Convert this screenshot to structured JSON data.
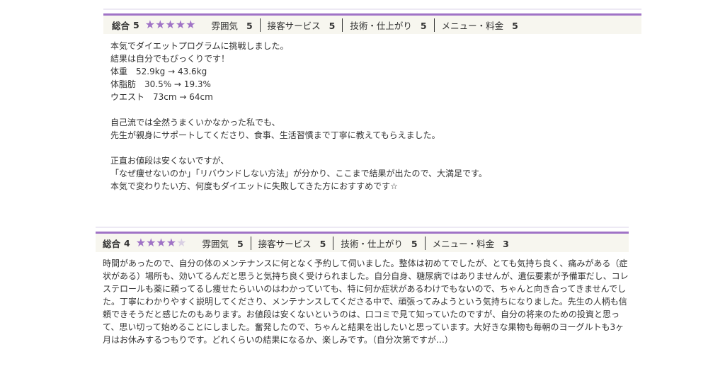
{
  "reviews": [
    {
      "total_label": "総合",
      "total_score": "5",
      "stars_filled": 5,
      "stars_max": 5,
      "categories": [
        {
          "label": "雰囲気",
          "score": "5"
        },
        {
          "label": "接客サービス",
          "score": "5"
        },
        {
          "label": "技術・仕上がり",
          "score": "5"
        },
        {
          "label": "メニュー・料金",
          "score": "5"
        }
      ],
      "lines": [
        "本気でダイエットプログラムに挑戦しました。",
        "結果は自分でもびっくりです！",
        "体重　52.9kg → 43.6kg",
        "体脂肪　30.5% → 19.3%",
        "ウエスト　73cm → 64cm",
        "",
        "自己流では全然うまくいかなかった私でも、",
        "先生が親身にサポートしてくださり、食事、生活習慣まで丁寧に教えてもらえました。",
        "",
        "正直お値段は安くないですが、",
        "「なぜ痩せないのか」「リバウンドしない方法」が分かり、ここまで結果が出たので、大満足です。",
        "本気で変わりたい方、何度もダイエットに失敗してきた方におすすめです☆"
      ]
    },
    {
      "total_label": "総合",
      "total_score": "4",
      "stars_filled": 4,
      "stars_max": 5,
      "categories": [
        {
          "label": "雰囲気",
          "score": "5"
        },
        {
          "label": "接客サービス",
          "score": "5"
        },
        {
          "label": "技術・仕上がり",
          "score": "5"
        },
        {
          "label": "メニュー・料金",
          "score": "3"
        }
      ],
      "lines": [
        "時間があったので、自分の体のメンテナンスに何となく予約して伺いました。整体は初めてでしたが、とても気持ち良く、痛みがある（症",
        "状がある）場所も、効いてるんだと思うと気持ち良く受けられました。自分自身、糖尿病ではありませんが、遺伝要素が予備軍だし、コレ",
        "ステロールも薬に頼ってるし痩せたらいいのはわかっていても、特に何か症状があるわけでもないので、ちゃんと向き合ってきませんでし",
        "た。丁寧にわかりやすく説明してくださり、メンテナンスしてくださる中で、頑張ってみようという気持ちになりました。先生の人柄も信",
        "頼できそうだと感じたのもあります。お値段は安くないというのは、口コミで見て知っていたのですが、自分の将来のための投資と思っ",
        "て、思い切って始めることにしました。奮発したので、ちゃんと結果を出したいと思っています。大好きな果物も毎朝のヨーグルトも3ヶ",
        "月はお休みするつもりです。どれくらいの結果になるか、楽しみです。（自分次第ですが…）"
      ]
    }
  ],
  "colors": {
    "accent": "#a073c6",
    "star_empty": "#d9cfe3",
    "bar_bg": "#f7f6ef"
  }
}
